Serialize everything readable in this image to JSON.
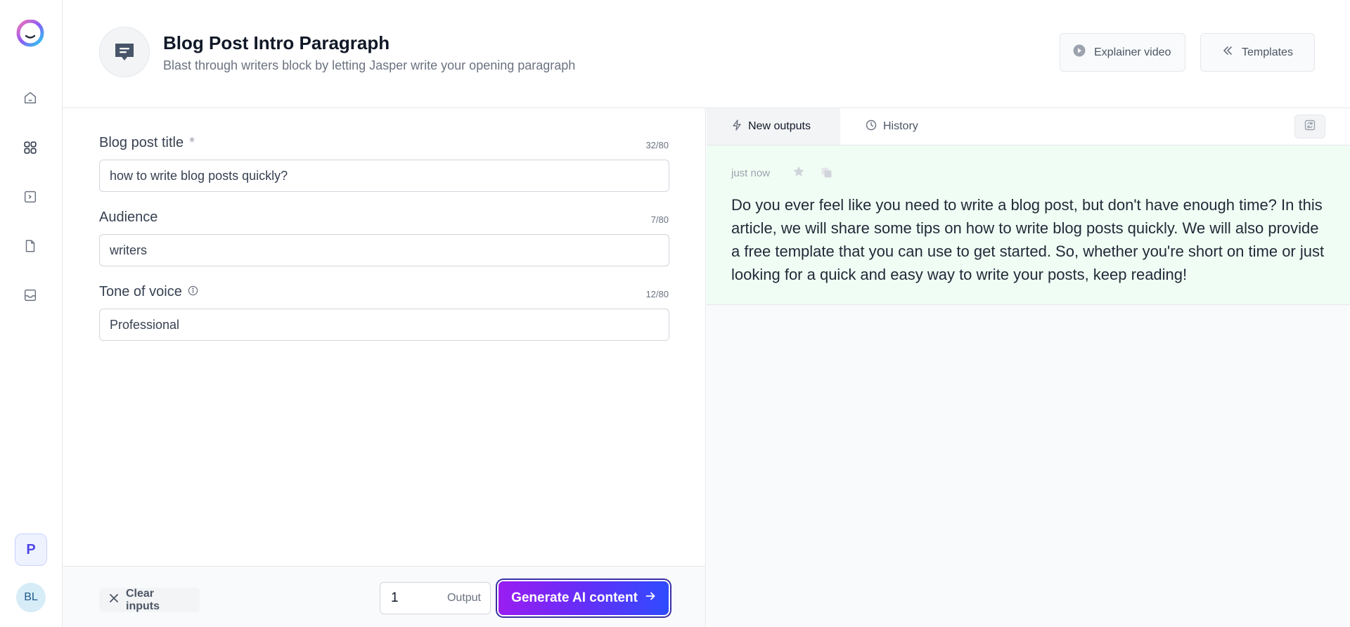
{
  "header": {
    "title": "Blog Post Intro Paragraph",
    "subtitle": "Blast through writers block by letting Jasper write your opening paragraph",
    "explainer_label": "Explainer video",
    "templates_label": "Templates"
  },
  "sidebar": {
    "items": [
      {
        "icon": "home-icon"
      },
      {
        "icon": "grid-icon"
      },
      {
        "icon": "terminal-icon"
      },
      {
        "icon": "document-icon"
      },
      {
        "icon": "inbox-icon"
      }
    ],
    "workspace_initial": "P",
    "user_initials": "BL"
  },
  "form": {
    "fields": [
      {
        "label": "Blog post title",
        "required": "*",
        "counter": "32/80",
        "value": "how to write blog posts quickly?"
      },
      {
        "label": "Audience",
        "counter": "7/80",
        "value": "writers"
      },
      {
        "label": "Tone of voice",
        "counter": "12/80",
        "value": "Professional"
      }
    ],
    "clear_label": "Clear inputs",
    "output_count": "1",
    "output_label": "Output",
    "generate_label": "Generate AI content"
  },
  "outputs": {
    "tabs": [
      {
        "label": "New outputs"
      },
      {
        "label": "History"
      }
    ],
    "result": {
      "time": "just now",
      "text": "Do you ever feel like you need to write a blog post, but don't have enough time? In this article, we will share some tips on how to write blog posts quickly. We will also provide a free template that you can use to get started. So, whether you're short on time or just looking for a quick and easy way to write your posts, keep reading!"
    }
  },
  "colors": {
    "accent_start": "#9a1df1",
    "accent_end": "#2f4bff",
    "result_bg": "#f0fdf4"
  }
}
